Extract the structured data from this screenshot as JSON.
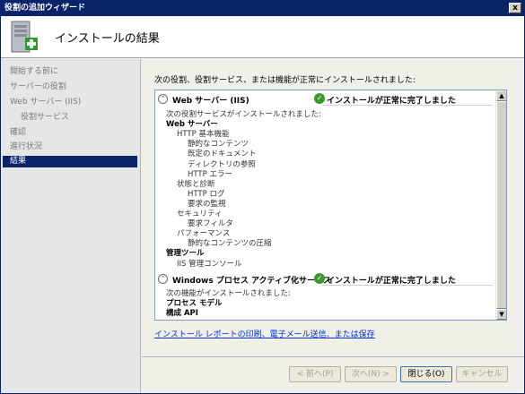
{
  "window": {
    "title": "役割の追加ウィザード",
    "close_label": "x"
  },
  "header": {
    "title": "インストールの結果"
  },
  "sidebar": {
    "items": [
      {
        "label": "開始する前に",
        "sub": false,
        "active": false
      },
      {
        "label": "サーバーの役割",
        "sub": false,
        "active": false
      },
      {
        "label": "Web サーバー (IIS)",
        "sub": false,
        "active": false
      },
      {
        "label": "役割サービス",
        "sub": true,
        "active": false
      },
      {
        "label": "確認",
        "sub": false,
        "active": false
      },
      {
        "label": "進行状況",
        "sub": false,
        "active": false
      },
      {
        "label": "結果",
        "sub": false,
        "active": true
      }
    ]
  },
  "main": {
    "intro": "次の役割、役割サービス、または機能が正常にインストールされました:",
    "sections": [
      {
        "title": "Web サーバー (IIS)",
        "status": "インストールが正常に完了しました",
        "lines": [
          {
            "text": "次の役割サービスがインストールされました:",
            "indent": 0,
            "bold": false
          },
          {
            "text": "Web サーバー",
            "indent": 0,
            "bold": true
          },
          {
            "text": "HTTP 基本機能",
            "indent": 1,
            "bold": false
          },
          {
            "text": "静的なコンテンツ",
            "indent": 2,
            "bold": false
          },
          {
            "text": "既定のドキュメント",
            "indent": 2,
            "bold": false
          },
          {
            "text": "ディレクトリの参照",
            "indent": 2,
            "bold": false
          },
          {
            "text": "HTTP エラー",
            "indent": 2,
            "bold": false
          },
          {
            "text": "状態と診断",
            "indent": 1,
            "bold": false
          },
          {
            "text": "HTTP ログ",
            "indent": 2,
            "bold": false
          },
          {
            "text": "要求の監視",
            "indent": 2,
            "bold": false
          },
          {
            "text": "セキュリティ",
            "indent": 1,
            "bold": false
          },
          {
            "text": "要求フィルタ",
            "indent": 2,
            "bold": false
          },
          {
            "text": "パフォーマンス",
            "indent": 1,
            "bold": false
          },
          {
            "text": "静的なコンテンツの圧縮",
            "indent": 2,
            "bold": false
          },
          {
            "text": "管理ツール",
            "indent": 0,
            "bold": true
          },
          {
            "text": "IIS 管理コンソール",
            "indent": 1,
            "bold": false
          }
        ]
      },
      {
        "title": "Windows プロセス アクティブ化サービス",
        "status": "インストールが正常に完了しました",
        "lines": [
          {
            "text": "次の機能がインストールされました:",
            "indent": 0,
            "bold": false
          },
          {
            "text": "プロセス モデル",
            "indent": 0,
            "bold": true
          },
          {
            "text": "構成 API",
            "indent": 0,
            "bold": true
          }
        ]
      }
    ],
    "link": "インストール レポートの印刷、電子メール送信、または保存"
  },
  "footer": {
    "back": "< 前へ(P)",
    "next": "次へ(N) >",
    "close": "閉じる(O)",
    "cancel": "キャンセル"
  },
  "colors": {
    "titlebar": "#0a246a",
    "active_nav": "#0a246a",
    "success": "#3a9a2a",
    "link": "#0033cc"
  }
}
